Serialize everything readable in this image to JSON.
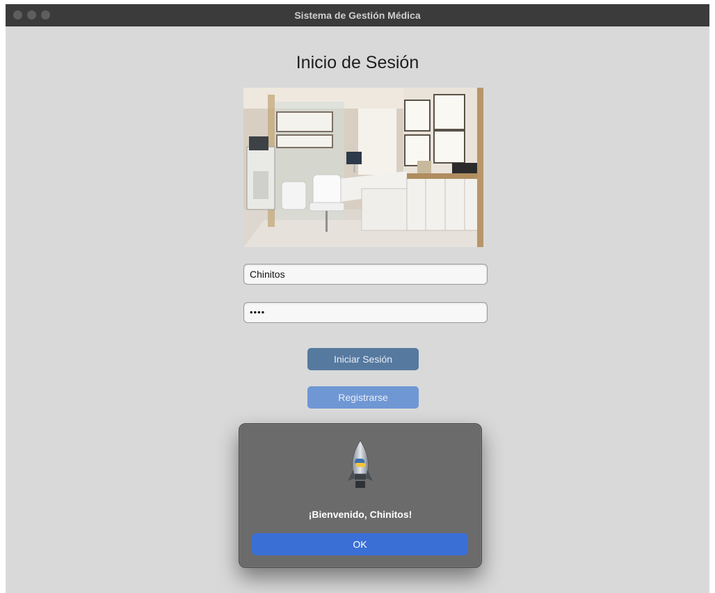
{
  "window": {
    "title": "Sistema de Gestión Médica"
  },
  "login": {
    "heading": "Inicio de Sesión",
    "username_value": "Chinitos",
    "password_value": "••••",
    "login_button": "Iniciar Sesión",
    "register_button": "Registrarse"
  },
  "dialog": {
    "message": "¡Bienvenido, Chinitos!",
    "ok_button": "OK",
    "icon": "python-rocket-icon"
  },
  "colors": {
    "login_button": "#56799f",
    "register_button": "#6f97d4",
    "ok_button": "#3a6fd6",
    "window_bg": "#d9d9d9",
    "dialog_bg": "#6b6b6b"
  }
}
